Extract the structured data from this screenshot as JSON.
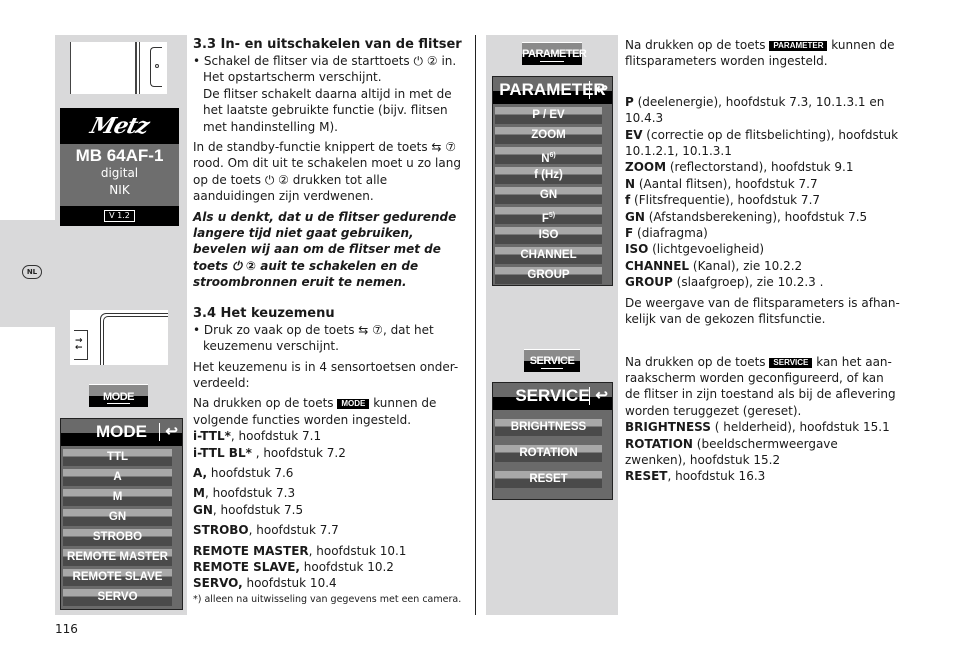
{
  "page": {
    "number": "116",
    "lang_badge": "NL"
  },
  "icons": {
    "power": "⏻",
    "circled_2": "②",
    "circled_7": "⑦",
    "swap": "⇆",
    "back": "↩"
  },
  "splash": {
    "logo": "Metz",
    "model": "MB 64AF-1",
    "line1": "digital",
    "line2": "NIK",
    "version": "V 1.2"
  },
  "keys": {
    "mode": "MODE",
    "parameter": "PARAMETER",
    "service": "SERVICE"
  },
  "mode_menu": {
    "title": "MODE",
    "items": [
      "TTL",
      "A",
      "M",
      "GN",
      "STROBO",
      "REMOTE MASTER",
      "REMOTE SLAVE",
      "SERVO"
    ]
  },
  "parameter_menu": {
    "title": "PARAMETER",
    "items": [
      "P / EV",
      "ZOOM",
      "N",
      "f (Hz)",
      "GN",
      "F",
      "ISO",
      "CHANNEL",
      "GROUP"
    ],
    "n_sup": "6)",
    "f_sup": "5)"
  },
  "service_menu": {
    "title": "SERVICE",
    "items": [
      "BRIGHTNESS",
      "ROTATION",
      "RESET"
    ]
  },
  "section33": {
    "heading": "3.3 In- en uitschakelen van de flitser",
    "bullet_a": "Schakel de flitser via de starttoets",
    "bullet_b": "in.",
    "bullet_c": "Het opstartscherm verschijnt.",
    "bullet_d": "De flitser schakelt daarna altijd in met de het laatste gebruikte functie (bijv. flitsen met handinstelling M).",
    "standby_a": "In de standby-functie knippert de toets",
    "standby_b": "rood. Om dit uit te schakelen moet u zo lang op de toets",
    "standby_c": "drukken tot alle aanduidingen zijn verdwenen.",
    "warning_a": "Als u denkt, dat u de flitser gedurende langere tijd niet gaat gebruiken, bevelen wij aan om de flitser met de toets",
    "warning_b": "auit te schakelen en de stroombronnen eruit te nemen."
  },
  "section34": {
    "heading": "3.4 Het keuzemenu",
    "bullet_a": "Druk zo vaak op de toets",
    "bullet_b": ", dat het keuzemenu verschijnt.",
    "para1": "Het keuzemenu is in 4 sensortoetsen onder-verdeeld:",
    "para2_a": "Na drukken op de toets",
    "para2_b": "kunnen de volgende functies worden ingesteld.",
    "entries": [
      {
        "term": "i-TTL*",
        "desc": ", hoofdstuk 7.1"
      },
      {
        "term": "i-TTL BL*",
        "desc": " , hoofdstuk 7.2"
      },
      {
        "term": "A,",
        "desc": " hoofdstuk 7.6"
      },
      {
        "term": "M",
        "desc": ", hoofdstuk 7.3"
      },
      {
        "term": "GN",
        "desc": ", hoofdstuk 7.5"
      },
      {
        "term": "STROBO",
        "desc": ", hoofdstuk 7.7"
      },
      {
        "term": "REMOTE MASTER",
        "desc": ", hoofdstuk 10.1"
      },
      {
        "term": "REMOTE SLAVE,",
        "desc": " hoofdstuk 10.2"
      },
      {
        "term": "SERVO,",
        "desc": " hoofdstuk 10.4"
      }
    ],
    "footnote": "*) alleen na uitwisseling van gegevens met een camera."
  },
  "parameter_text": {
    "intro_a": "Na drukken op de toets",
    "intro_b": "kunnen de flitsparameters worden ingesteld.",
    "entries": [
      {
        "term": "P",
        "desc": " (deelenergie), hoofdstuk 7.3, 10.1.3.1 en 10.4.3"
      },
      {
        "term": "EV",
        "desc": " (correctie op de flitsbelichting), hoofdstuk 10.1.2.1, 10.1.3.1"
      },
      {
        "term": "ZOOM",
        "desc": " (reflectorstand), hoofdstuk 9.1"
      },
      {
        "term": "N",
        "desc": " (Aantal flitsen), hoofdstuk 7.7"
      },
      {
        "term": "f",
        "desc": " (Flitsfrequentie), hoofdstuk 7.7"
      },
      {
        "term": "GN",
        "desc": " (Afstandsberekening), hoofdstuk 7.5"
      },
      {
        "term": "F",
        "desc": " (diafragma)"
      },
      {
        "term": "ISO",
        "desc": " (lichtgevoeligheid)"
      },
      {
        "term": "CHANNEL",
        "desc": " (Kanal), zie 10.2.2"
      },
      {
        "term": "GROUP",
        "desc": " (slaafgroep), zie 10.2.3 ."
      }
    ],
    "outro": "De weergave van de flitsparameters is afhan-kelijk van de gekozen flitsfunctie."
  },
  "service_text": {
    "intro_a": "Na drukken op de toets",
    "intro_b": "kan het aan-raakscherm worden geconfigureerd, of kan de flitser in zijn toestand als bij de aflevering worden teruggezet (gereset).",
    "entries": [
      {
        "term": "BRIGHTNESS",
        "desc": " ( helderheid), hoofdstuk 15.1"
      },
      {
        "term": "ROTATION",
        "desc": " (beeldschermweergave zwenken), hoofdstuk 15.2"
      },
      {
        "term": "RESET",
        "desc": ", hoofdstuk 16.3"
      }
    ]
  }
}
